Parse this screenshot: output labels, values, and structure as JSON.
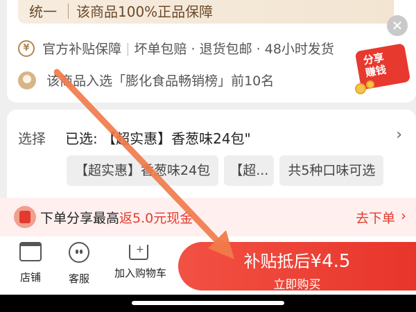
{
  "guarantee": {
    "left": "统一",
    "right": "该商品100%正品保障"
  },
  "services": {
    "icon": "¥",
    "text_a": "官方补贴保障",
    "text_b": "坏单包赔 · 退货包邮 · 48小时发货"
  },
  "ranking": {
    "text": "该商品入选「膨化食品畅销榜」前10名"
  },
  "share_sticker": {
    "line1": "分享",
    "line2": "赚钱"
  },
  "selection": {
    "label": "选择",
    "value": "已选: 【超实惠】香葱味24包\"",
    "chips": [
      "【超实惠】香葱味24包",
      "【超...",
      "共5种口味可选"
    ]
  },
  "promo": {
    "prefix": "下单分享最高",
    "highlight": "返5.0元现金",
    "cta": "去下单"
  },
  "bottom_nav": {
    "store": "店铺",
    "service": "客服",
    "cart": "加入购物车"
  },
  "buy": {
    "main": "补贴抵后",
    "price": "¥4.5",
    "sub": "立即购买"
  },
  "colors": {
    "accent": "#e8352b",
    "gold": "#b0864e",
    "promo_bg": "#fff0ef"
  },
  "icons": {
    "close": "close-icon",
    "store": "store-icon",
    "service": "face-icon",
    "cart": "cart-icon"
  }
}
